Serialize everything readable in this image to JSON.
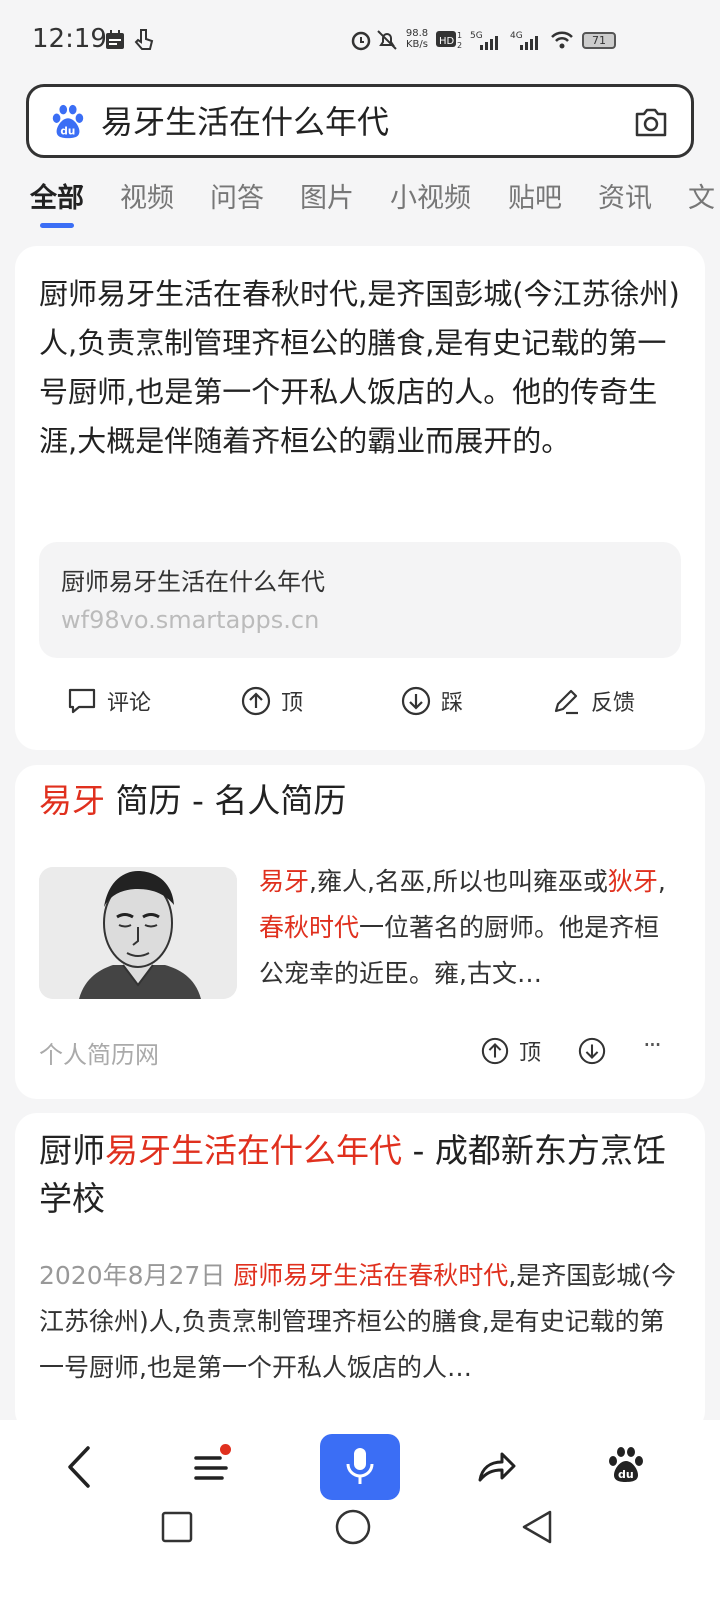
{
  "status": {
    "time": "12:19",
    "net_speed": "98.8",
    "net_unit": "KB/s",
    "battery": "71"
  },
  "search": {
    "query": "易牙生活在什么年代"
  },
  "tabs": [
    {
      "label": "全部"
    },
    {
      "label": "视频"
    },
    {
      "label": "问答"
    },
    {
      "label": "图片"
    },
    {
      "label": "小视频"
    },
    {
      "label": "贴吧"
    },
    {
      "label": "资讯"
    },
    {
      "label": "文"
    }
  ],
  "answer_card": {
    "text": "厨师易牙生活在春秋时代,是齐国彭城(今江苏徐州)人,负责烹制管理齐桓公的膳食,是有史记载的第一号厨师,也是第一个开私人饭店的人。他的传奇生涯,大概是伴随着齐桓公的霸业而展开的。",
    "source_title": "厨师易牙生活在什么年代",
    "source_url": "wf98vo.smartapps.cn",
    "actions": {
      "comment": "评论",
      "up": "顶",
      "down": "踩",
      "feedback": "反馈"
    }
  },
  "result2": {
    "title_red": "易牙",
    "title_rest": " 简历 - 名人简历",
    "snippet": {
      "p1_red": "易牙",
      "p2": ",雍人,名巫,所以也叫雍巫或",
      "p3_red": "狄牙",
      "p4": ",",
      "p5_red": "春秋时代",
      "p6": "一位著名的厨师。他是齐桓公宠幸的近臣。雍,古文…"
    },
    "site": "个人简历网",
    "up_label": "顶",
    "more": "···"
  },
  "result3": {
    "title_p1": "厨师",
    "title_red": "易牙生活在什么年代",
    "title_p2": " - 成都新东方烹饪学校",
    "date": "2020年8月27日",
    "snippet_red": "厨师易牙生活在春秋时代",
    "snippet_rest": ",是齐国彭城(今江苏徐州)人,负责烹制管理齐桓公的膳食,是有史记载的第一号厨师,也是第一个开私人饭店的人…"
  },
  "colors": {
    "accent": "#3b6ef5",
    "highlight": "#e0301e"
  }
}
